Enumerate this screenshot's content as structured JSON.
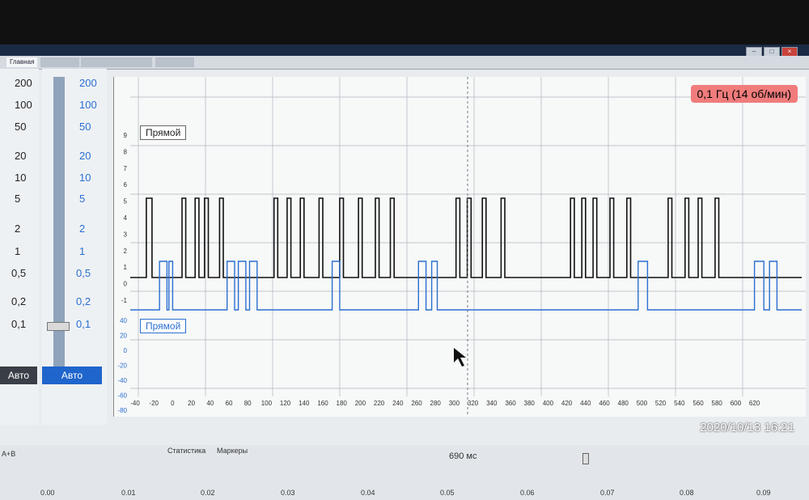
{
  "window": {
    "tabs": [
      "Главная",
      "",
      "",
      ""
    ],
    "controls": [
      "–",
      "□",
      "×"
    ]
  },
  "left_scale": {
    "labels": [
      "200",
      "100",
      "50",
      "20",
      "10",
      "5",
      "2",
      "1",
      "0,5",
      "0,2",
      "0,1"
    ],
    "auto": "Авто"
  },
  "right_scale": {
    "labels": [
      "200",
      "100",
      "50",
      "20",
      "10",
      "5",
      "2",
      "1",
      "0,5",
      "0,2",
      "0,1"
    ],
    "auto": "Авто"
  },
  "channel_a": {
    "label": "Прямой"
  },
  "channel_b": {
    "label": "Прямой"
  },
  "frequency": "0,1 Гц (14 об/мин)",
  "bottom": {
    "stats_tab": "Статистика",
    "markers_tab": "Маркеры",
    "window_time": "690 мс",
    "ab": "A+B",
    "time_axis": [
      "0.00",
      "0.01",
      "0.02",
      "0.03",
      "0.04",
      "0.05",
      "0.06",
      "0.07",
      "0.08",
      "0.09"
    ]
  },
  "timestamp": "2020/10/13  16:21",
  "chart_data": {
    "type": "line",
    "x_ticks": [
      "-40",
      "-20",
      "0",
      "20",
      "40",
      "60",
      "80",
      "100",
      "120",
      "140",
      "160",
      "180",
      "200",
      "220",
      "240",
      "260",
      "280",
      "300",
      "320",
      "340",
      "360",
      "380",
      "400",
      "420",
      "440",
      "460",
      "480",
      "500",
      "520",
      "540",
      "560",
      "580",
      "600",
      "620"
    ],
    "y_ticks_top": [
      "9",
      "8",
      "7",
      "6",
      "5",
      "4",
      "3",
      "2",
      "1",
      "0",
      "-1"
    ],
    "y_ticks_bottom": [
      "40",
      "20",
      "0",
      "-20",
      "-40",
      "-60",
      "-80"
    ],
    "series": [
      {
        "name": "",
        "color": "#111111",
        "segments": [
          [
            -28,
            -22
          ],
          [
            10,
            14
          ],
          [
            24,
            28
          ],
          [
            34,
            38
          ],
          [
            50,
            54
          ],
          [
            108,
            112
          ],
          [
            122,
            126
          ],
          [
            136,
            140
          ],
          [
            156,
            160
          ],
          [
            178,
            182
          ],
          [
            198,
            202
          ],
          [
            216,
            220
          ],
          [
            232,
            236
          ],
          [
            302,
            306
          ],
          [
            314,
            318
          ],
          [
            330,
            334
          ],
          [
            350,
            354
          ],
          [
            424,
            428
          ],
          [
            436,
            440
          ],
          [
            448,
            452
          ],
          [
            466,
            470
          ],
          [
            484,
            488
          ],
          [
            528,
            532
          ],
          [
            546,
            550
          ],
          [
            560,
            564
          ],
          [
            578,
            582
          ]
        ]
      },
      {
        "name": "",
        "color": "#2a6fd1",
        "segments": [
          [
            -14,
            -6
          ],
          [
            -4,
            0
          ],
          [
            58,
            66
          ],
          [
            70,
            78
          ],
          [
            82,
            90
          ],
          [
            170,
            178
          ],
          [
            262,
            270
          ],
          [
            276,
            282
          ],
          [
            496,
            506
          ],
          [
            620,
            630
          ],
          [
            636,
            644
          ]
        ]
      }
    ]
  }
}
